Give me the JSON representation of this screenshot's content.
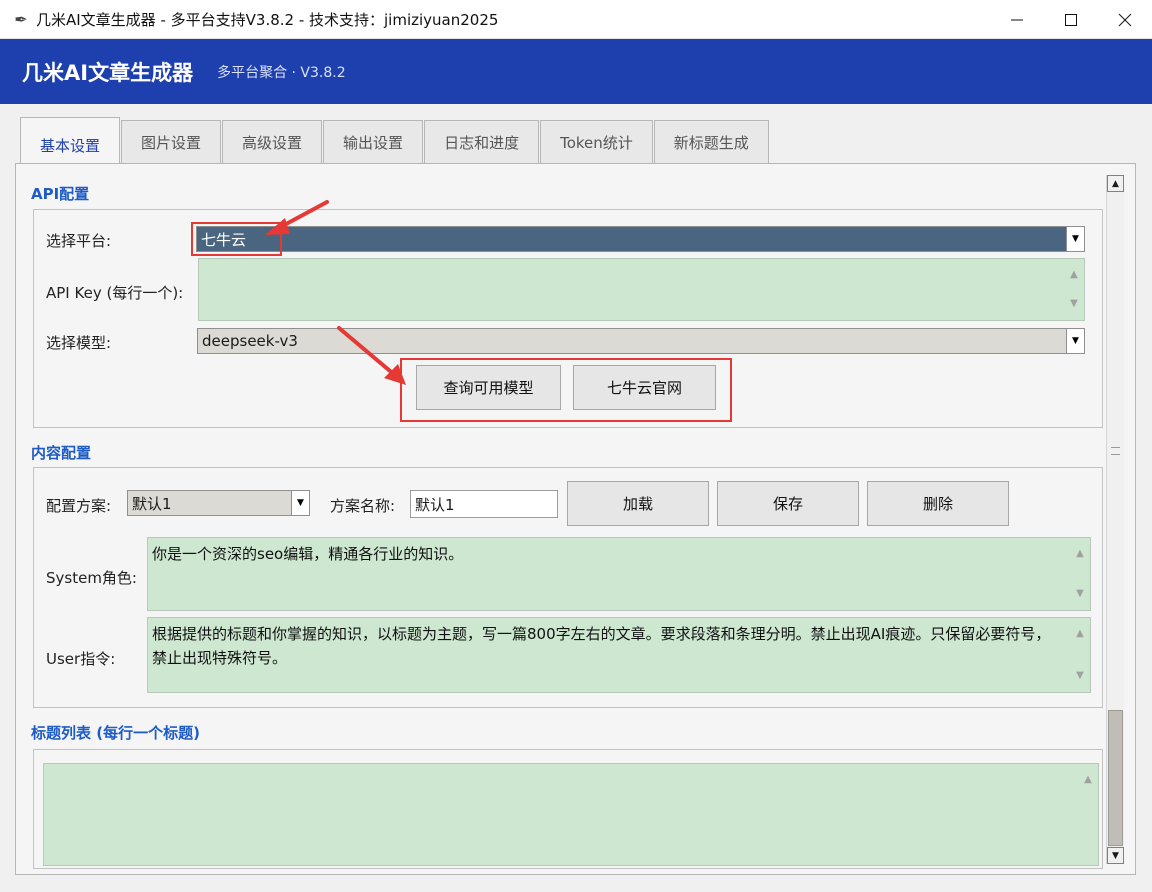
{
  "window": {
    "title": "几米AI文章生成器 - 多平台支持V3.8.2 - 技术支持：jimiziyuan2025",
    "icon": "feather-icon"
  },
  "header": {
    "title": "几米AI文章生成器",
    "subtitle": "多平台聚合 · V3.8.2",
    "color": "#1e40af"
  },
  "tabs": [
    {
      "label": "基本设置",
      "active": true
    },
    {
      "label": "图片设置"
    },
    {
      "label": "高级设置"
    },
    {
      "label": "输出设置"
    },
    {
      "label": "日志和进度"
    },
    {
      "label": "Token统计"
    },
    {
      "label": "新标题生成"
    }
  ],
  "api_config": {
    "section_title": "API配置",
    "platform_label": "选择平台:",
    "platform_value": "七牛云",
    "apikey_label": "API Key (每行一个):",
    "apikey_value": "",
    "model_label": "选择模型:",
    "model_value": "deepseek-v3",
    "query_button": "查询可用模型",
    "site_button": "七牛云官网"
  },
  "content_config": {
    "section_title": "内容配置",
    "scheme_label": "配置方案:",
    "scheme_value": "默认1",
    "scheme_name_label": "方案名称:",
    "scheme_name_value": "默认1",
    "load_button": "加载",
    "save_button": "保存",
    "delete_button": "删除",
    "system_label": "System角色:",
    "system_value": "你是一个资深的seo编辑，精通各行业的知识。",
    "user_label": "User指令:",
    "user_value": "根据提供的标题和你掌握的知识，以标题为主题，写一篇800字左右的文章。要求段落和条理分明。禁止出现AI痕迹。只保留必要符号，禁止出现特殊符号。"
  },
  "title_list": {
    "section_title": "标题列表 (每行一个标题)",
    "value": ""
  },
  "colors": {
    "textarea_bg": "#cde7d0",
    "platform_combo_bg": "#4a6580",
    "accent": "#1e5bc6",
    "annotation": "#e53935"
  }
}
